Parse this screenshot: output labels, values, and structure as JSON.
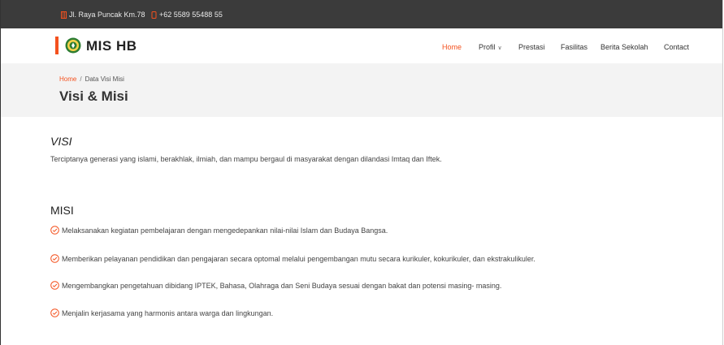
{
  "topbar": {
    "address": "Jl. Raya Puncak Km.78",
    "phone": "+62 5589 55488 55"
  },
  "brand": {
    "name": "MIS HB",
    "accent_color": "#f4511e"
  },
  "nav": {
    "items": [
      {
        "label": "Home",
        "active": true
      },
      {
        "label": "Profil",
        "has_dropdown": true
      },
      {
        "label": "Prestasi"
      },
      {
        "label": "Fasilitas"
      },
      {
        "label": "Berita Sekolah"
      },
      {
        "label": "Contact"
      }
    ]
  },
  "breadcrumb": {
    "home": "Home",
    "separator": "/",
    "current": "Data Visi Misi"
  },
  "page": {
    "title": "Visi & Misi"
  },
  "visi": {
    "heading": "VISI",
    "text": "Terciptanya generasi yang islami, berakhlak, ilmiah, dan mampu bergaul di masyarakat dengan dilandasi Imtaq dan Iftek."
  },
  "misi": {
    "heading": "MISI",
    "items": [
      "Melaksanakan kegiatan pembelajaran dengan mengedepankan nilai-nilai Islam dan Budaya Bangsa.",
      "Memberikan pelayanan pendidikan dan pengajaran secara optomal melalui pengembangan mutu secara kurikuler, kokurikuler, dan ekstrakulikuler.",
      "Mengembangkan pengetahuan dibidang IPTEK, Bahasa, Olahraga dan Seni Budaya sesuai dengan bakat dan potensi masing- masing.",
      "Menjalin kerjasama yang harmonis antara warga dan lingkungan."
    ]
  }
}
